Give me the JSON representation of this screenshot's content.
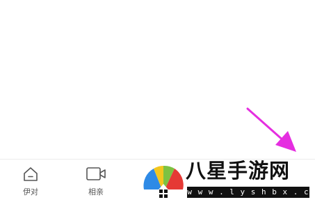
{
  "tab_bar": {
    "tabs": [
      {
        "label": "伊对",
        "icon": "home-icon"
      },
      {
        "label": "相亲",
        "icon": "video-camera-icon"
      }
    ]
  },
  "annotation": {
    "arrow_color": "#e52ee0"
  },
  "watermark": {
    "title": "八星手游网",
    "url": "w w w . l y s h b x . c o m",
    "logo_colors": [
      "#2e8ae6",
      "#f2c61f",
      "#7dc242",
      "#e53935"
    ]
  }
}
